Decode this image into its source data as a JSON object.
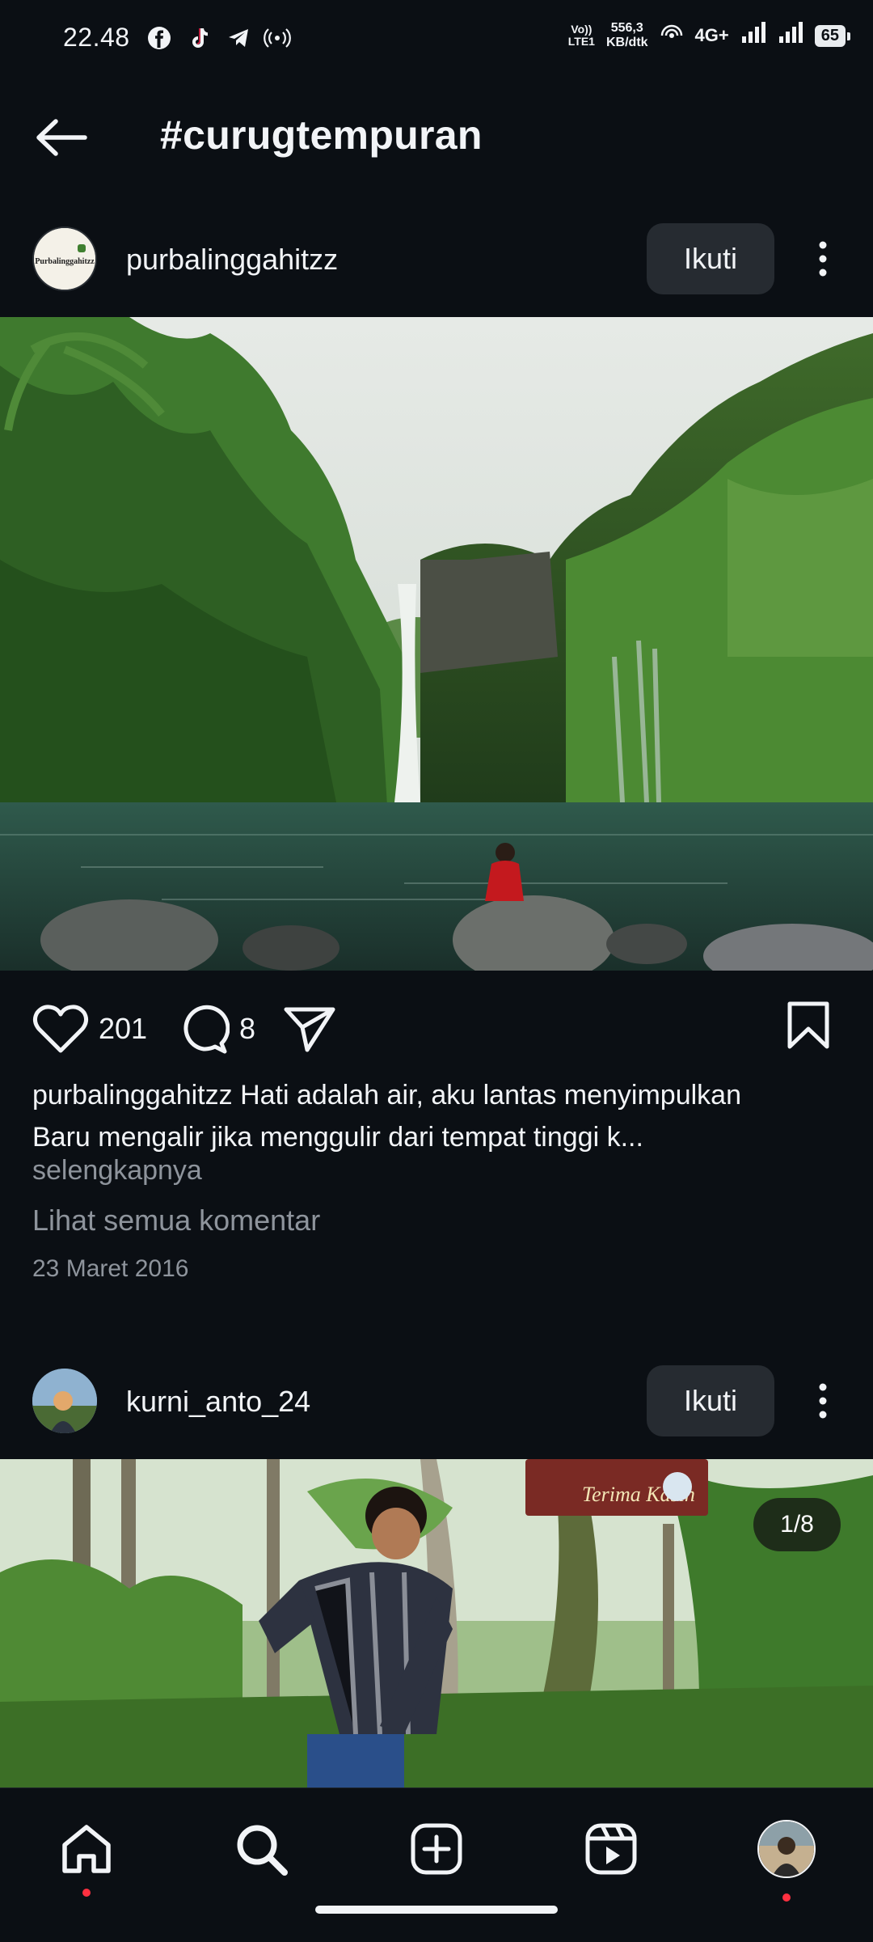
{
  "status_bar": {
    "time": "22.48",
    "network_small_top": "Vo))",
    "network_small_bottom": "LTE1",
    "speed_top": "556,3",
    "speed_bottom": "KB/dtk",
    "network_type": "4G+",
    "battery": "65"
  },
  "header": {
    "title": "#curugtempuran"
  },
  "posts": [
    {
      "username": "purbalinggahitzz",
      "avatar_text": "Purbalinggahitzz",
      "follow_label": "Ikuti",
      "likes": "201",
      "comments": "8",
      "caption_user": "purbalinggahitzz",
      "caption_line1": "Hati adalah air, aku lantas menyimpulkan",
      "caption_line2": "Baru mengalir jika menggulir dari tempat tinggi k...",
      "more_label": "selengkapnya",
      "view_comments_label": "Lihat semua komentar",
      "date": "23 Maret 2016"
    },
    {
      "username": "kurni_anto_24",
      "follow_label": "Ikuti",
      "carousel_counter": "1/8",
      "sign_text": "Terima Kasih"
    }
  ],
  "colors": {
    "background": "#0b0f14",
    "button_bg": "#262b31",
    "muted_text": "#8e949c",
    "notification_dot": "#ff3040"
  },
  "nav": {
    "items": [
      "home-icon",
      "search-icon",
      "create-icon",
      "reels-icon",
      "profile-avatar"
    ]
  }
}
